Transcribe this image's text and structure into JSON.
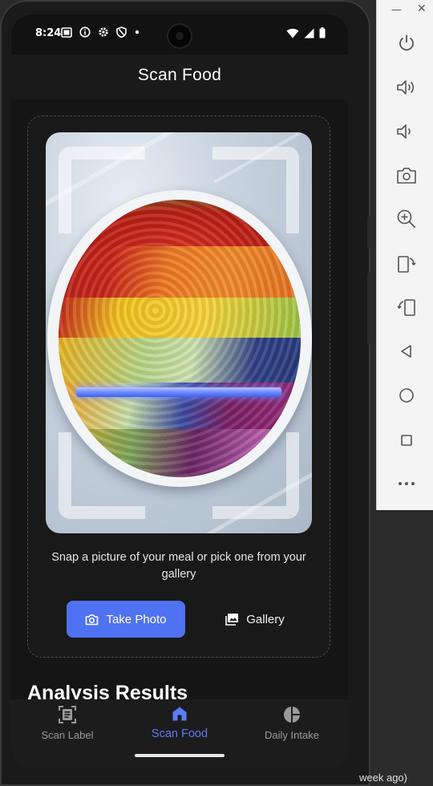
{
  "status_bar": {
    "time": "8:24",
    "left_icons": [
      "screen-record-icon",
      "info-icon",
      "settings-gear-icon",
      "shield-icon",
      "dot-icon"
    ],
    "right_icons": [
      "wifi-icon",
      "signal-icon",
      "battery-icon"
    ]
  },
  "header": {
    "title": "Scan Food"
  },
  "scan_card": {
    "instruction": "Snap a picture of your meal or pick one from your gallery",
    "take_photo_label": "Take Photo",
    "gallery_label": "Gallery"
  },
  "analysis": {
    "title": "Analysis Results"
  },
  "bottom_nav": {
    "items": [
      {
        "label": "Scan Label",
        "icon": "scan-label-icon",
        "active": false
      },
      {
        "label": "Scan Food",
        "icon": "home-icon",
        "active": true
      },
      {
        "label": "Daily Intake",
        "icon": "pie-chart-icon",
        "active": false
      }
    ]
  },
  "emulator_toolbar": {
    "buttons": [
      "power-icon",
      "volume-up-icon",
      "volume-down-icon",
      "camera-icon",
      "zoom-in-icon",
      "rotate-left-icon",
      "rotate-right-icon",
      "back-icon",
      "home-circle-icon",
      "overview-icon",
      "more-icon"
    ]
  },
  "background_snippet": "week ago)",
  "colors": {
    "accent": "#4f72f2",
    "active_nav": "#5b7cf7",
    "background": "#121212"
  }
}
